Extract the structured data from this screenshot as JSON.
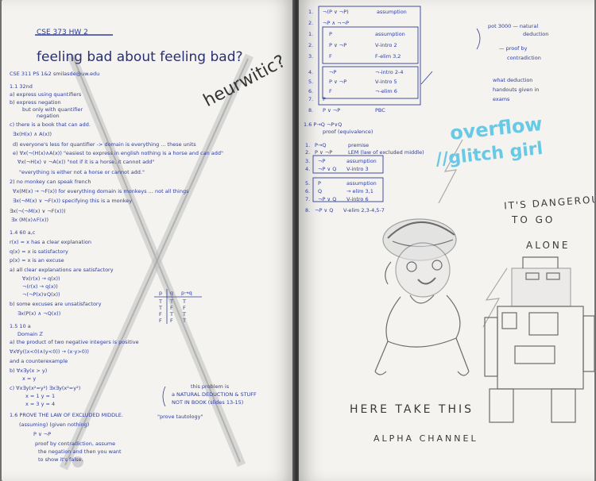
{
  "left_page": {
    "top_strike": "CSE 373 HW 2",
    "heading": "feeling bad about feeling bad?",
    "contact": "CSE 311 PS 1&2 smilasde@uw.edu",
    "lines": [
      "1.1 32nd",
      "a) express using quantifiers",
      "b) express negation",
      "but only with quantifier",
      "negation",
      "c) there is a book that can add.",
      "∃x(H(x) ∧ A(x))",
      "d) everyone's less for quantifier -> domain is everything ... these units",
      "e) ∀x(¬(H(x)∧A(x)) \"easiest to express in english  nothing is a horse and can add\"",
      "∀x(¬H(x) ∨ ¬A(x))   \"not if it is a horse, it cannot add\"",
      "\"everything is either not a horse or cannot add.\"",
      "2) no monkey can speak french",
      "∀x(M(x) → ¬F(x))   for everything domain is monkeys ... not all things",
      "∃x(¬M(x) ∨ ¬F(x))   specifying this is a monkey",
      "∃x(¬(¬M(x) ∨ ¬F(x)))",
      "∃x (M(x)∧F(x))",
      "1.4 60 a,c",
      "r(x) = x has a clear explanation",
      "q(x) = x is satisfactory",
      "p(x) = x is an excuse",
      "a) all clear explanations are satisfactory",
      "∀x(r(x) → q(x))",
      "¬(r(x) → q(x))",
      "¬(¬P(x)∨Q(x))",
      "b) some excuses are unsatisfactory",
      "∃x(P(x) ∧ ¬Q(x))",
      "1.5 10 a",
      "Domain ℤ",
      "a) the product of two negative integers is positive",
      "∀x∀y((x<0)∧(y<0)) → (x·y>0))",
      "and a counterexample",
      "b) ∀x∃y(x > y)",
      "x = y",
      "c) ∀x∃y(x²=y²)    ∃x∃y(x²=y²)",
      "x = 1 y = 1",
      "x = 3 y = 4",
      "1.6 PROVE THE LAW OF EXCLUDED MIDDLE.",
      "(assuming) (given nothing)",
      "P ∨ ¬P",
      "proof by contradiction, assume",
      "the negation and then you want",
      "to show it's false."
    ],
    "notes": [
      "this problem is",
      "a NATURAL DEDUCTION & STUFF",
      "NOT IN BOOK (slides 13-15)",
      "\"prove tautology\""
    ],
    "truth_table": {
      "headers": [
        "p",
        "q",
        "p→q"
      ],
      "rows": [
        [
          "T",
          "T",
          "T"
        ],
        [
          "T",
          "F",
          "F"
        ],
        [
          "F",
          "T",
          "T"
        ],
        [
          "F",
          "F",
          "T"
        ]
      ]
    },
    "pencil_word": "heurwitic?"
  },
  "right_page": {
    "proof_top": [
      {
        "n": "1.",
        "stmt": "¬(P ∨ ¬P)",
        "just": "assumption"
      },
      {
        "n": "2.",
        "stmt": "¬P ∧ ¬¬P",
        "just": ""
      },
      {
        "n": "1.",
        "stmt": "P",
        "just": "assumption"
      },
      {
        "n": "2.",
        "stmt": "P ∨ ¬P",
        "just": "V-intro 2"
      },
      {
        "n": "3.",
        "stmt": "F",
        "just": "F-elim 3,2"
      },
      {
        "n": "4.",
        "stmt": "¬P",
        "just": "¬-intro 2-4"
      },
      {
        "n": "5.",
        "stmt": "P ∨ ¬P",
        "just": "V-intro 5"
      },
      {
        "n": "6.",
        "stmt": "F",
        "just": "¬-elim 6"
      },
      {
        "n": "7.",
        "stmt": "P",
        "just": ""
      },
      {
        "n": "8.",
        "stmt": "P ∨ ¬P",
        "just": "PBC"
      }
    ],
    "side_notes": [
      "pot 3000 — natural",
      "deduction",
      "— proof by",
      "contradiction",
      "what deduction",
      "handouts given in",
      "exams"
    ],
    "mid_title": "1.6 P→Q  ¬P∨Q",
    "mid_subtitle": "proof (equivalence)",
    "proof_mid": [
      {
        "n": "1.",
        "stmt": "P→Q",
        "just": "premise"
      },
      {
        "n": "2.",
        "stmt": "P ∨ ¬P",
        "just": "LEM (law of excluded middle)"
      },
      {
        "n": "3.",
        "stmt": "¬P",
        "just": "assumption"
      },
      {
        "n": "4.",
        "stmt": "¬P ∨ Q",
        "just": "V-intro 3"
      },
      {
        "n": "5.",
        "stmt": "P",
        "just": "assumption"
      },
      {
        "n": "6.",
        "stmt": "Q",
        "just": "→ elim 3,1"
      },
      {
        "n": "7.",
        "stmt": "¬P ∨ Q",
        "just": "V-intro 6"
      },
      {
        "n": "8.",
        "stmt": "¬P ∨ Q",
        "just": "V-elim 2,3-4,5-7"
      }
    ],
    "cyan_line1": "overflow",
    "cyan_line2": "//glitch girl",
    "dangerous": [
      "IT'S DANGEROUS",
      "TO GO",
      "ALONE"
    ],
    "take_this": "HERE TAKE THIS",
    "alpha": "ALPHA CHANNEL"
  }
}
